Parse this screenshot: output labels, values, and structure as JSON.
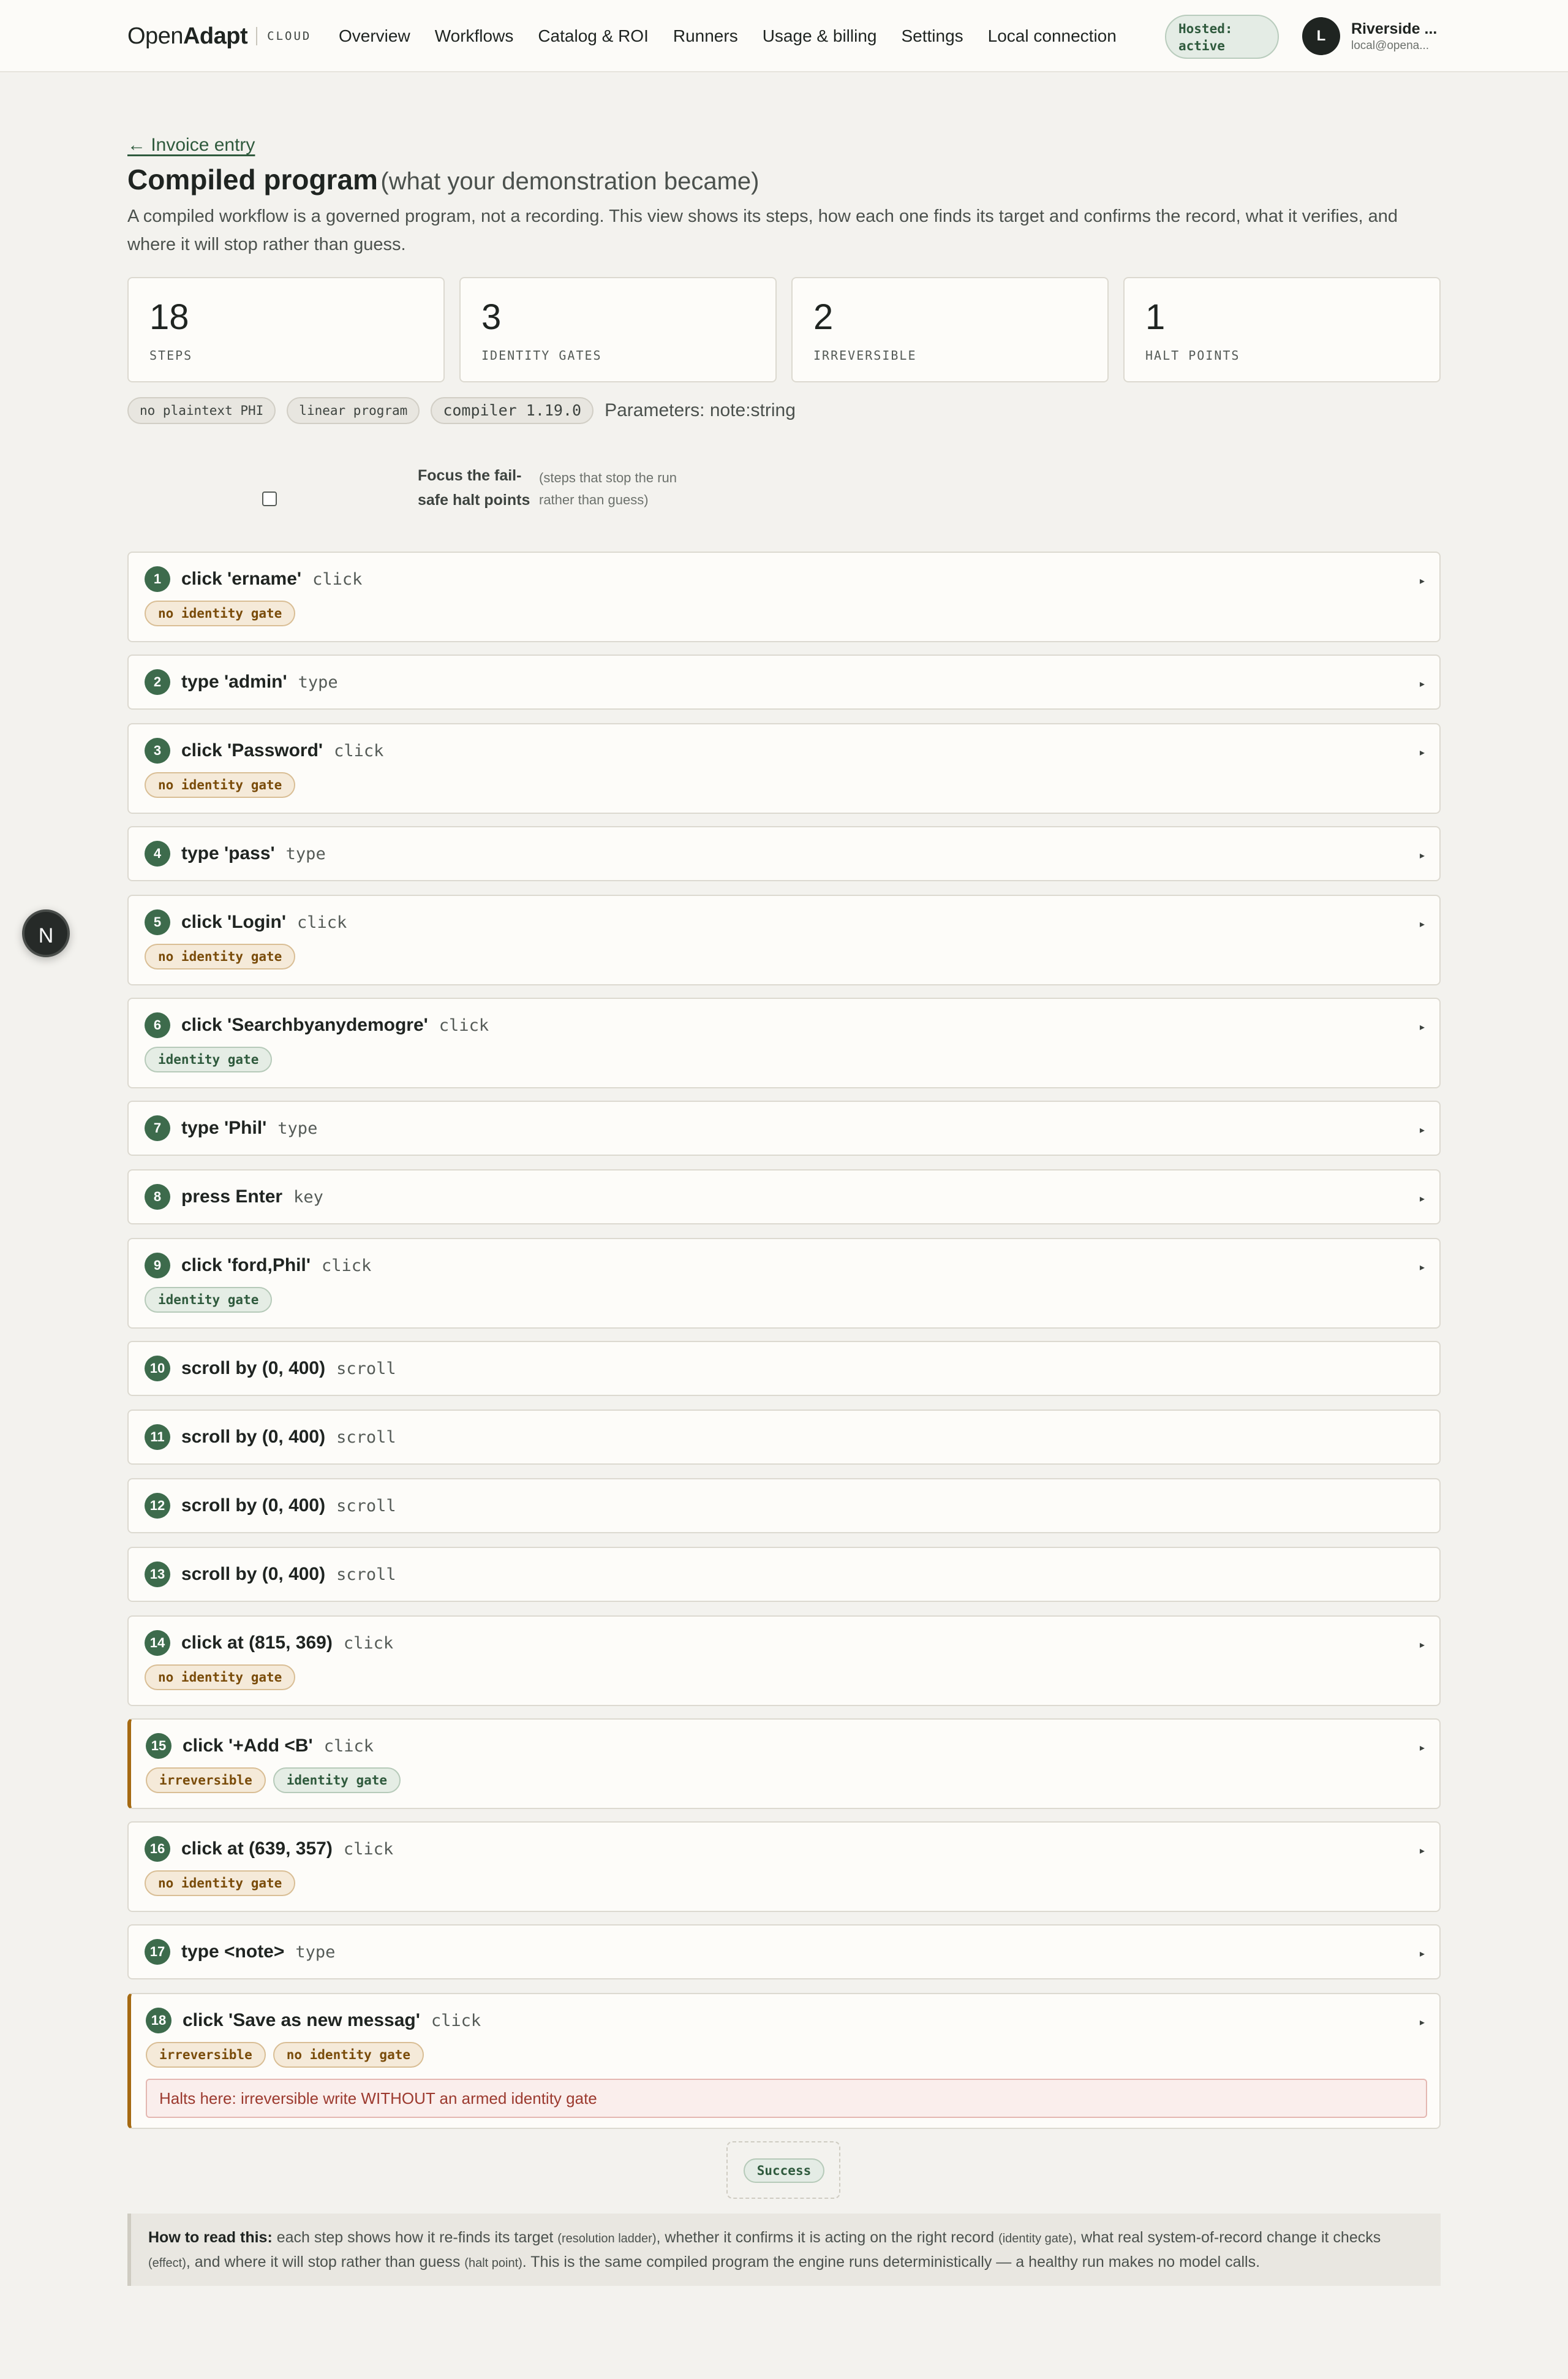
{
  "nav": {
    "brand_prefix": "Open",
    "brand_bold": "Adapt",
    "brand_tag": "CLOUD",
    "items": [
      "Overview",
      "Workflows",
      "Catalog & ROI",
      "Runners",
      "Usage & billing",
      "Settings",
      "Local connection"
    ],
    "hosted_line1": "Hosted:",
    "hosted_line2": "active",
    "avatar_initial": "L",
    "user_name": "Riverside ...",
    "user_email": "local@opena..."
  },
  "float_badge": "N",
  "header": {
    "back_link": "← Invoice entry",
    "title": "Compiled program",
    "subtitle": "(what your demonstration became)",
    "description": "A compiled workflow is a governed program, not a recording. This view shows its steps, how each one finds its target and confirms the record, what it verifies, and where it will stop rather than guess."
  },
  "stats": [
    {
      "value": "18",
      "label": "STEPS"
    },
    {
      "value": "3",
      "label": "IDENTITY GATES"
    },
    {
      "value": "2",
      "label": "IRREVERSIBLE"
    },
    {
      "value": "1",
      "label": "HALT POINTS"
    }
  ],
  "chips": {
    "phi": "no plaintext PHI",
    "program": "linear program",
    "compiler": "compiler 1.19.0",
    "parameters": "Parameters: note:string"
  },
  "focus": {
    "label": "Focus the fail-safe halt points",
    "hint": "(steps that stop the run rather than guess)",
    "checked": false
  },
  "steps": [
    {
      "n": "1",
      "title": "click 'ername'",
      "kind": "click",
      "tags": [
        "no identity gate"
      ],
      "halt": false
    },
    {
      "n": "2",
      "title": "type 'admin'",
      "kind": "type",
      "tags": [],
      "halt": false
    },
    {
      "n": "3",
      "title": "click 'Password'",
      "kind": "click",
      "tags": [
        "no identity gate"
      ],
      "halt": false
    },
    {
      "n": "4",
      "title": "type 'pass'",
      "kind": "type",
      "tags": [],
      "halt": false
    },
    {
      "n": "5",
      "title": "click 'Login'",
      "kind": "click",
      "tags": [
        "no identity gate"
      ],
      "halt": false
    },
    {
      "n": "6",
      "title": "click 'Searchbyanydemogre'",
      "kind": "click",
      "tags": [
        "identity gate"
      ],
      "halt": false
    },
    {
      "n": "7",
      "title": "type 'Phil'",
      "kind": "type",
      "tags": [],
      "halt": false
    },
    {
      "n": "8",
      "title": "press Enter",
      "kind": "key",
      "tags": [],
      "halt": false
    },
    {
      "n": "9",
      "title": "click 'ford,Phil'",
      "kind": "click",
      "tags": [
        "identity gate"
      ],
      "halt": false
    },
    {
      "n": "10",
      "title": "scroll by (0, 400)",
      "kind": "scroll",
      "tags": [],
      "halt": false,
      "chevron": false
    },
    {
      "n": "11",
      "title": "scroll by (0, 400)",
      "kind": "scroll",
      "tags": [],
      "halt": false,
      "chevron": false
    },
    {
      "n": "12",
      "title": "scroll by (0, 400)",
      "kind": "scroll",
      "tags": [],
      "halt": false,
      "chevron": false
    },
    {
      "n": "13",
      "title": "scroll by (0, 400)",
      "kind": "scroll",
      "tags": [],
      "halt": false,
      "chevron": false
    },
    {
      "n": "14",
      "title": "click at (815, 369)",
      "kind": "click",
      "tags": [
        "no identity gate"
      ],
      "halt": false
    },
    {
      "n": "15",
      "title": "click '+Add <B'",
      "kind": "click",
      "tags": [
        "irreversible",
        "identity gate"
      ],
      "halt": true
    },
    {
      "n": "16",
      "title": "click at (639, 357)",
      "kind": "click",
      "tags": [
        "no identity gate"
      ],
      "halt": false
    },
    {
      "n": "17",
      "title": "type <note>",
      "kind": "type",
      "tags": [],
      "halt": false
    },
    {
      "n": "18",
      "title": "click 'Save as new messag'",
      "kind": "click",
      "tags": [
        "irreversible",
        "no identity gate"
      ],
      "halt": true,
      "halt_note": "Halts here: irreversible write WITHOUT an armed identity gate"
    }
  ],
  "chevron_glyph": "▸",
  "result": "Success",
  "how_to_read": {
    "lead": "How to read this:",
    "t1": " each step shows how it re-finds its target ",
    "s1": "(resolution ladder)",
    "t2": ", whether it confirms it is acting on the right record ",
    "s2": "(identity gate)",
    "t3": ", what real system-of-record change it checks ",
    "s3": "(effect)",
    "t4": ", and where it will stop rather than guess ",
    "s4": "(halt point)",
    "t5": ". This is the same compiled program the engine runs deterministically — a healthy run makes no model calls."
  }
}
